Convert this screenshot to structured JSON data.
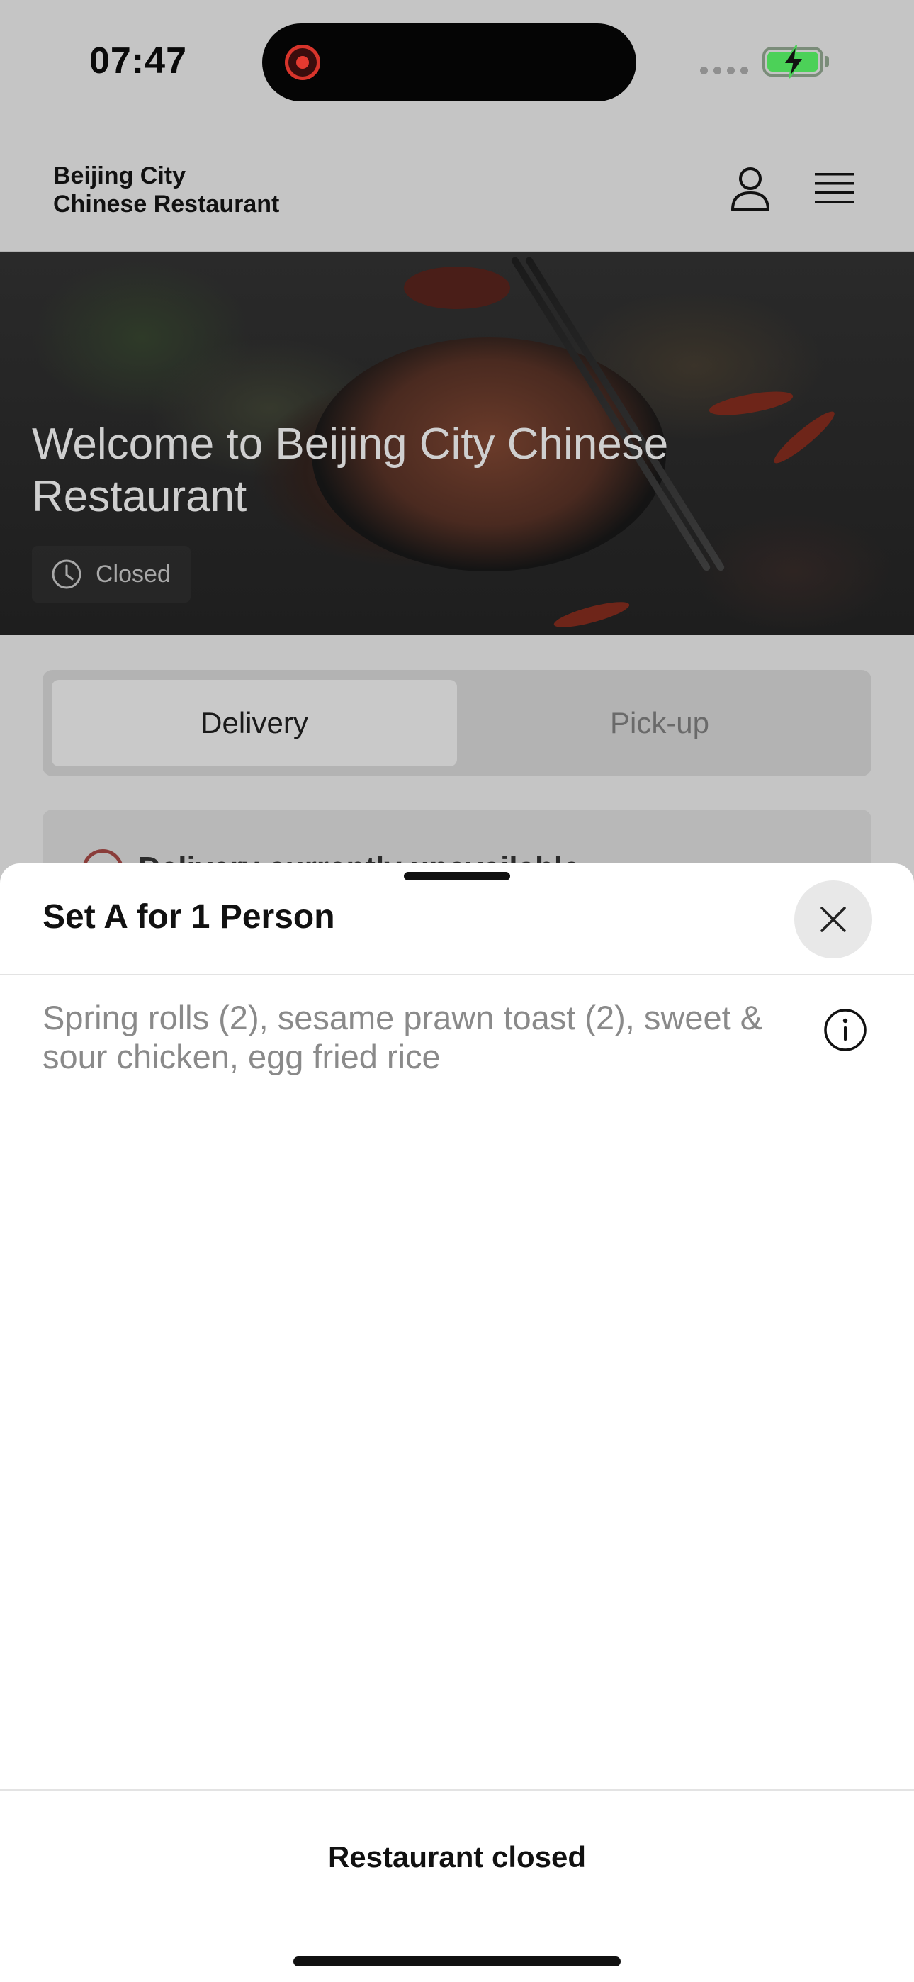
{
  "status_bar": {
    "time": "07:47",
    "icons": [
      "screen-recording-icon",
      "signal-icon",
      "battery-charging-icon"
    ],
    "battery_color": "#4cd158",
    "record_color": "#e53a30"
  },
  "header": {
    "brand_line1": "Beijing City",
    "brand_line2": "Chinese Restaurant",
    "icons": [
      "user-icon",
      "menu-icon"
    ]
  },
  "hero": {
    "title": "Welcome to Beijing City Chinese Restaurant",
    "status_label": "Closed",
    "status_icon": "clock-icon"
  },
  "mode_tabs": {
    "items": [
      {
        "label": "Delivery",
        "selected": true
      },
      {
        "label": "Pick-up",
        "selected": false
      }
    ]
  },
  "notice": {
    "text": "Delivery currently unavailable",
    "icon": "warning-circle-icon"
  },
  "sheet": {
    "title": "Set A for 1 Person",
    "description": "Spring rolls (2), sesame prawn toast (2), sweet & sour chicken, egg fried rice",
    "close_icon": "close-icon",
    "info_icon": "info-icon",
    "footer_label": "Restaurant closed"
  },
  "colors": {
    "overlay_dim": "#c5c5c5",
    "sheet_bg": "#ffffff",
    "muted_text": "#8a8a8a"
  }
}
